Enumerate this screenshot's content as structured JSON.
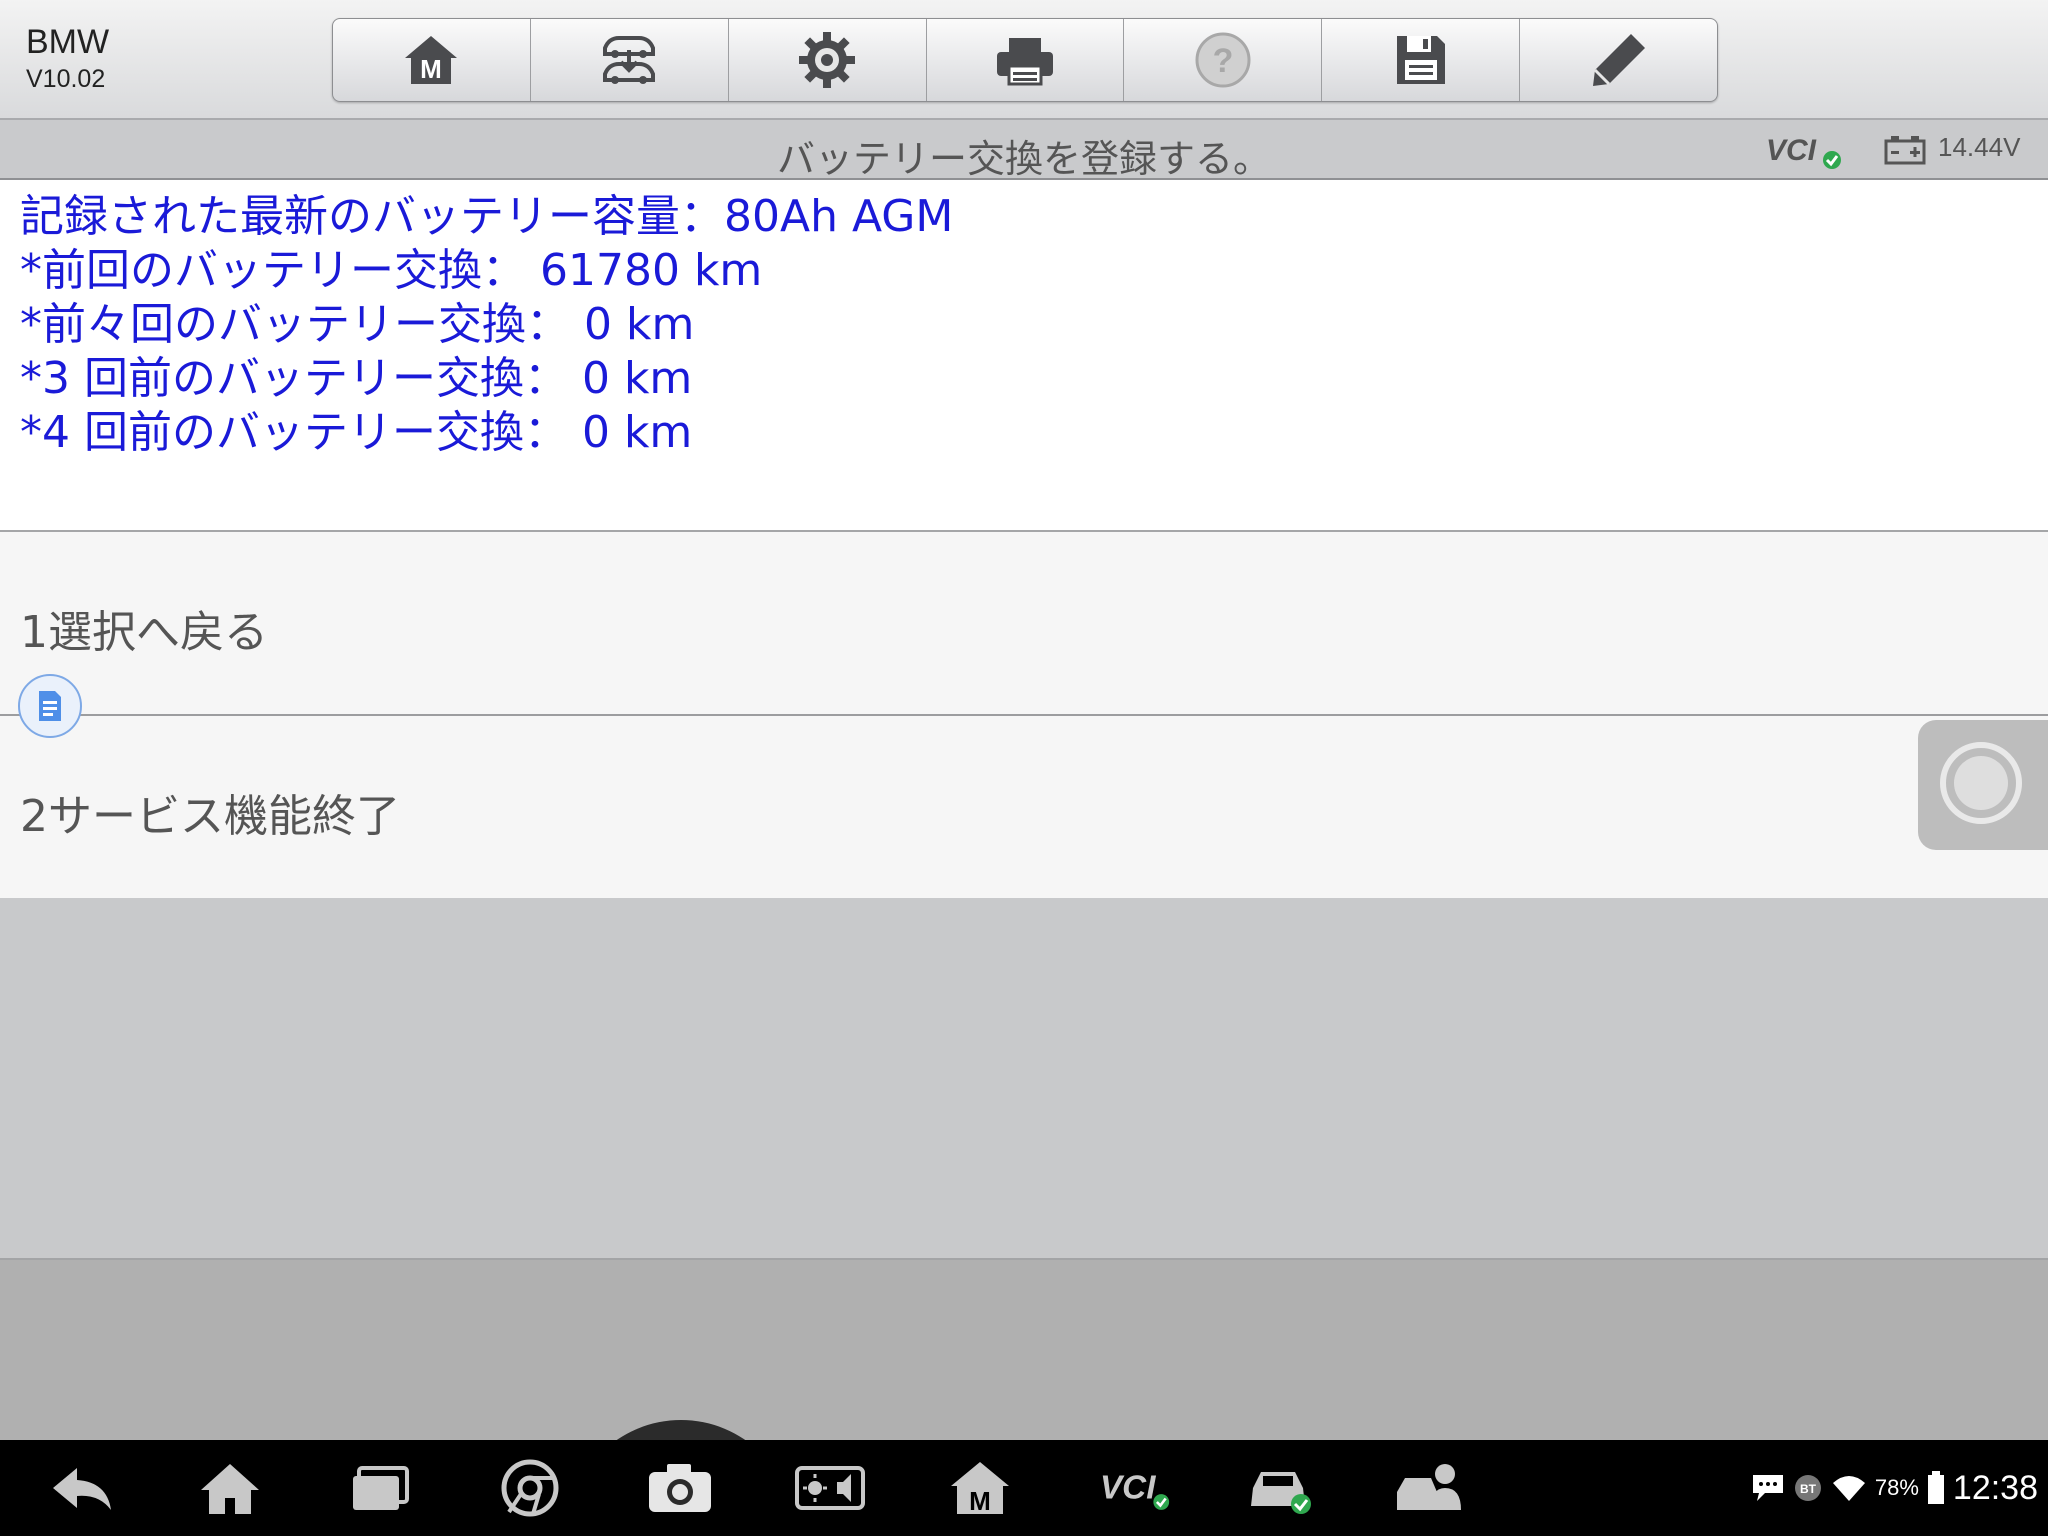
{
  "header": {
    "brand_name": "BMW",
    "version": "V10.02",
    "toolbar": [
      {
        "name": "home-m-button",
        "icon": "m-home-icon"
      },
      {
        "name": "vehicle-swap-button",
        "icon": "vehicle-swap-icon"
      },
      {
        "name": "settings-button",
        "icon": "gear-icon"
      },
      {
        "name": "print-button",
        "icon": "printer-icon"
      },
      {
        "name": "help-button",
        "icon": "help-icon"
      },
      {
        "name": "save-button",
        "icon": "floppy-icon"
      },
      {
        "name": "edit-button",
        "icon": "pencil-icon"
      }
    ]
  },
  "subheader": {
    "title": "バッテリー交換を登録する。",
    "vcl_label": "VCI",
    "voltage": "14.44V"
  },
  "info": {
    "color": "#1a1ad8",
    "lines": [
      "記録された最新のバッテリー容量：80Ah AGM",
      "*前回のバッテリー交換： 61780 km",
      "*前々回のバッテリー交換： 0 km",
      "*3 回前のバッテリー交換： 0 km",
      "*4 回前のバッテリー交換： 0 km"
    ]
  },
  "menu": {
    "items": [
      {
        "label": "1選択へ戻る"
      },
      {
        "label": "2サービス機能終了"
      }
    ]
  },
  "navbar": {
    "vcl_label": "VCI",
    "battery_percent": "78%",
    "time": "12:38",
    "bt_label": "BT"
  }
}
